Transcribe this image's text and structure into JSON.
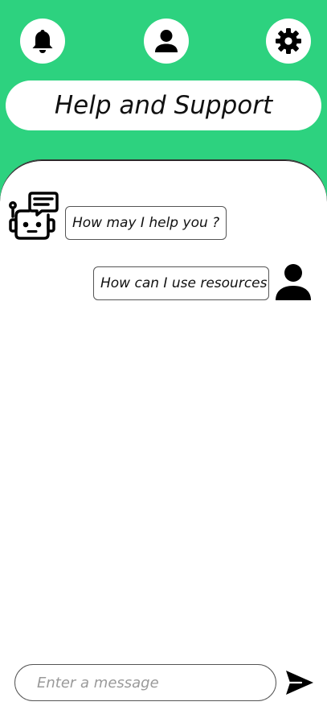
{
  "header": {
    "title": "Help and Support",
    "accent_color": "#2dd27f",
    "icons": [
      "bell-icon",
      "user-icon",
      "gear-icon"
    ]
  },
  "chat": {
    "messages": [
      {
        "sender": "bot",
        "text": "How may I help you ?"
      },
      {
        "sender": "user",
        "text": "How can I use resources"
      }
    ]
  },
  "composer": {
    "placeholder": "Enter a message",
    "value": ""
  }
}
